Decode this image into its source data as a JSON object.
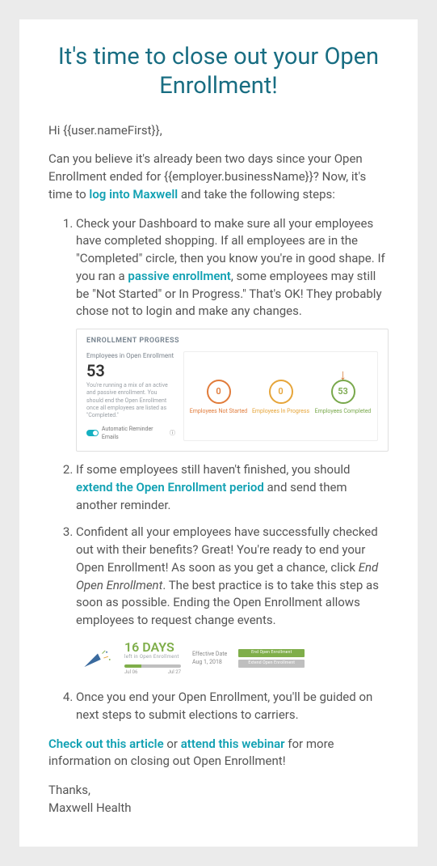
{
  "title": "It's time to close out your Open Enrollment!",
  "greeting": "Hi {{user.nameFirst}},",
  "intro": {
    "part1": "Can you believe it's already been two days since your Open Enrollment ended for {{employer.businessName}}? Now, it's time to ",
    "link": "log into Maxwell",
    "part2": " and take the following steps:"
  },
  "steps": {
    "s1": {
      "part1": "Check your Dashboard to make sure all your employees have completed shopping. If all employees are in the \"Completed\" circle, then you know you're in good shape. If you ran a ",
      "link": "passive enrollment",
      "part2": ", some employees may still be \"Not Started\" or In Progress.\" That's OK! They probably chose not to login and make any changes."
    },
    "s2": {
      "part1": "If some employees still haven't finished, you should ",
      "link": "extend the Open Enrollment period",
      "part2": " and send them another reminder."
    },
    "s3": {
      "part1": "Confident all your employees have successfully checked out with their benefits? Great! You're ready to end your Open Enrollment! As soon as you get a chance, click ",
      "em": "End Open Enrollment",
      "part2": ". The best practice is to take this step as soon as possible. Ending the Open Enrollment allows employees to request change events."
    },
    "s4": "Once you end your Open Enrollment, you'll be guided on next steps to submit elections to carriers."
  },
  "outro": {
    "link1": "Check out this article",
    "mid1": " or ",
    "link2": "attend this webinar",
    "part2": " for more information on closing out Open Enrollment!"
  },
  "signoff": {
    "l1": "Thanks,",
    "l2": "Maxwell Health"
  },
  "shot1": {
    "title": "ENROLLMENT PROGRESS",
    "left_sub": "Employees in Open Enrollment",
    "total": "53",
    "desc": "You're running a mix of an active and passive enrollment. You should end the Open Enrollment once all employees are listed as \"Completed.\"",
    "toggle_label": "Automatic Reminder Emails",
    "stats": [
      {
        "value": "0",
        "label": "Employees Not Started"
      },
      {
        "value": "0",
        "label": "Employees In Progress"
      },
      {
        "value": "53",
        "label": "Employees Completed"
      }
    ]
  },
  "shot2": {
    "days": "16 DAYS",
    "days_sub": "left in Open Enrollment",
    "date_start": "Jul 06",
    "date_end": "Jul 27",
    "eff_label": "Effective Date",
    "eff_value": "Aug 1, 2018",
    "btn1": "End Open Enrollment",
    "btn2": "Extend Open Enrollment"
  }
}
